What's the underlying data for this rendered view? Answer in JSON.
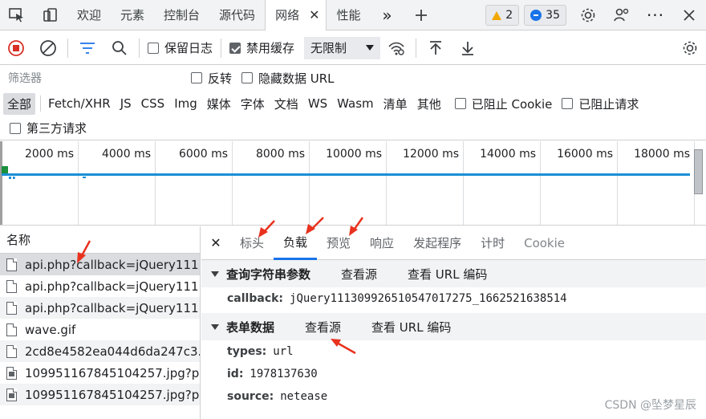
{
  "tabs": [
    {
      "label": "欢迎"
    },
    {
      "label": "元素"
    },
    {
      "label": "控制台"
    },
    {
      "label": "源代码"
    },
    {
      "label": "网络",
      "active": true
    },
    {
      "label": "性能"
    }
  ],
  "badges": {
    "warnings": "2",
    "messages": "35"
  },
  "toolbar": {
    "preserve_log": "保留日志",
    "disable_cache": "禁用缓存",
    "throttle": "无限制"
  },
  "filter": {
    "placeholder": "筛选器",
    "invert": "反转",
    "hide_data_url": "隐藏数据 URL"
  },
  "types": [
    "全部",
    "Fetch/XHR",
    "JS",
    "CSS",
    "Img",
    "媒体",
    "字体",
    "文档",
    "WS",
    "Wasm",
    "清单",
    "其他"
  ],
  "blocked": {
    "cookies": "已阻止 Cookie",
    "requests": "已阻止请求",
    "third_party": "第三方请求"
  },
  "timeline": {
    "ticks": [
      "2000 ms",
      "4000 ms",
      "6000 ms",
      "8000 ms",
      "10000 ms",
      "12000 ms",
      "14000 ms",
      "16000 ms",
      "18000 ms"
    ]
  },
  "requests": {
    "header": "名称",
    "items": [
      "api.php?callback=jQuery111...",
      "api.php?callback=jQuery111...",
      "api.php?callback=jQuery111...",
      "wave.gif",
      "2cd8e4582ea044d6da247c3...",
      "109951167845104257.jpg?p...",
      "109951167845104257.jpg?p..."
    ]
  },
  "detail_tabs": [
    "标头",
    "负载",
    "预览",
    "响应",
    "发起程序",
    "计时",
    "Cookie"
  ],
  "query": {
    "title": "查询字符串参数",
    "view_source": "查看源",
    "view_encoded": "查看 URL 编码",
    "params": [
      {
        "key": "callback:",
        "value": "jQuery111309926510547017275_1662521638514"
      }
    ]
  },
  "form": {
    "title": "表单数据",
    "view_source": "查看源",
    "view_encoded": "查看 URL 编码",
    "params": [
      {
        "key": "types:",
        "value": "url"
      },
      {
        "key": "id:",
        "value": "1978137630"
      },
      {
        "key": "source:",
        "value": "netease"
      }
    ]
  },
  "watermark": "CSDN @坠梦星辰",
  "colors": {
    "accent": "#1a73e8",
    "annotation": "#e8321e",
    "record": "#d93025"
  }
}
